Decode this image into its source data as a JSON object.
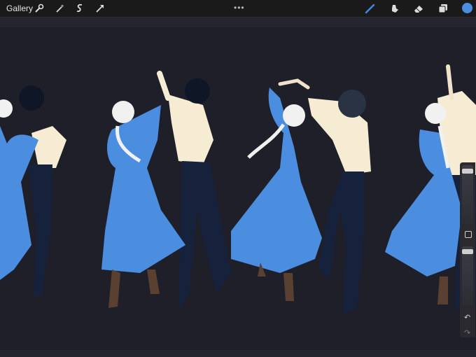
{
  "topbar": {
    "gallery_label": "Gallery",
    "more_glyph": "•••",
    "left_tools": [
      "wrench-icon",
      "magic-wand-icon",
      "selection-icon",
      "transform-icon"
    ],
    "right_tools": [
      "brush-icon",
      "smudge-icon",
      "eraser-icon",
      "layers-icon"
    ],
    "current_color": "#4b8ee0"
  },
  "sidebar": {
    "brush_size_level": 0.06,
    "opacity_level": 0.05,
    "undo_glyph": "↶",
    "redo_glyph": "↷"
  },
  "canvas": {
    "background": "#1e1f29",
    "dress_color": "#4b8ee0",
    "shirt_color": "#f6ecd3",
    "pants_color": "#16223c"
  }
}
